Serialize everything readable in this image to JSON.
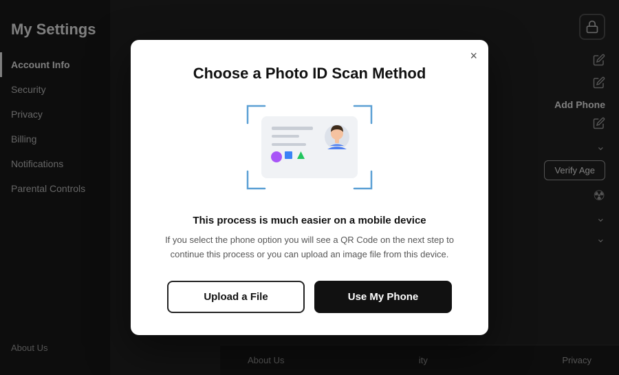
{
  "page": {
    "title": "My Settings"
  },
  "sidebar": {
    "items": [
      {
        "label": "Account Info",
        "active": true
      },
      {
        "label": "Security",
        "active": false
      },
      {
        "label": "Privacy",
        "active": false
      },
      {
        "label": "Billing",
        "active": false
      },
      {
        "label": "Notifications",
        "active": false
      },
      {
        "label": "Parental Controls",
        "active": false
      }
    ],
    "footer_label": "About Us"
  },
  "main": {
    "add_phone_label": "Add Phone",
    "verify_age_button": "Verify Age"
  },
  "footer": {
    "links": [
      "About Us",
      "ity",
      "Privacy"
    ]
  },
  "modal": {
    "title": "Choose a Photo ID Scan Method",
    "subtitle": "This process is much easier on a mobile device",
    "description": "If you select the phone option you will see a QR Code on the next step to continue this process or you can upload an image file from this device.",
    "upload_button": "Upload a File",
    "phone_button": "Use My Phone",
    "close_label": "×"
  }
}
